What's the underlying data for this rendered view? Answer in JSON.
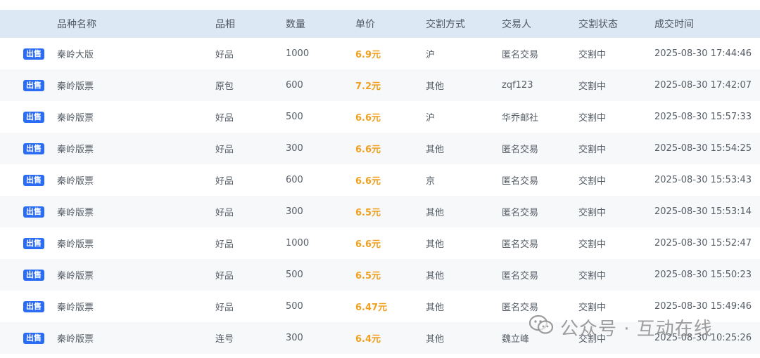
{
  "header": {
    "name": "品种名称",
    "quality": "品相",
    "qty": "数量",
    "price": "单价",
    "method": "交割方式",
    "trader": "交易人",
    "status": "交割状态",
    "time": "成交时间"
  },
  "rows": [
    {
      "tag": "出售",
      "name": "秦岭大版",
      "quality": "好品",
      "qty": "1000",
      "price": "6.9元",
      "method": "沪",
      "trader": "匿名交易",
      "status": "交割中",
      "time": "2025-08-30 17:44:46"
    },
    {
      "tag": "出售",
      "name": "秦岭版票",
      "quality": "原包",
      "qty": "600",
      "price": "7.2元",
      "method": "其他",
      "trader": "zqf123",
      "status": "交割中",
      "time": "2025-08-30 17:42:07"
    },
    {
      "tag": "出售",
      "name": "秦岭版票",
      "quality": "好品",
      "qty": "500",
      "price": "6.6元",
      "method": "沪",
      "trader": "华乔邮社",
      "status": "交割中",
      "time": "2025-08-30 15:57:33"
    },
    {
      "tag": "出售",
      "name": "秦岭版票",
      "quality": "好品",
      "qty": "300",
      "price": "6.6元",
      "method": "其他",
      "trader": "匿名交易",
      "status": "交割中",
      "time": "2025-08-30 15:54:25"
    },
    {
      "tag": "出售",
      "name": "秦岭版票",
      "quality": "好品",
      "qty": "600",
      "price": "6.6元",
      "method": "京",
      "trader": "匿名交易",
      "status": "交割中",
      "time": "2025-08-30 15:53:43"
    },
    {
      "tag": "出售",
      "name": "秦岭版票",
      "quality": "好品",
      "qty": "300",
      "price": "6.5元",
      "method": "其他",
      "trader": "匿名交易",
      "status": "交割中",
      "time": "2025-08-30 15:53:14"
    },
    {
      "tag": "出售",
      "name": "秦岭版票",
      "quality": "好品",
      "qty": "1000",
      "price": "6.6元",
      "method": "其他",
      "trader": "匿名交易",
      "status": "交割中",
      "time": "2025-08-30 15:52:47"
    },
    {
      "tag": "出售",
      "name": "秦岭版票",
      "quality": "好品",
      "qty": "500",
      "price": "6.5元",
      "method": "其他",
      "trader": "匿名交易",
      "status": "交割中",
      "time": "2025-08-30 15:50:23"
    },
    {
      "tag": "出售",
      "name": "秦岭版票",
      "quality": "好品",
      "qty": "500",
      "price": "6.47元",
      "method": "其他",
      "trader": "匿名交易",
      "status": "交割中",
      "time": "2025-08-30 15:49:46"
    },
    {
      "tag": "出售",
      "name": "秦岭版票",
      "quality": "连号",
      "qty": "300",
      "price": "6.4元",
      "method": "其他",
      "trader": "魏立峰",
      "status": "交割中",
      "time": "2025-08-30 10:25:26"
    }
  ],
  "watermark": {
    "icon": "wechat-icon",
    "text": "公众号 · 互动在线"
  },
  "colors": {
    "header_bg": "#dde8f5",
    "tag_bg": "#2a6df4",
    "price": "#f0a020",
    "row_alt": "#f7f8fa"
  }
}
